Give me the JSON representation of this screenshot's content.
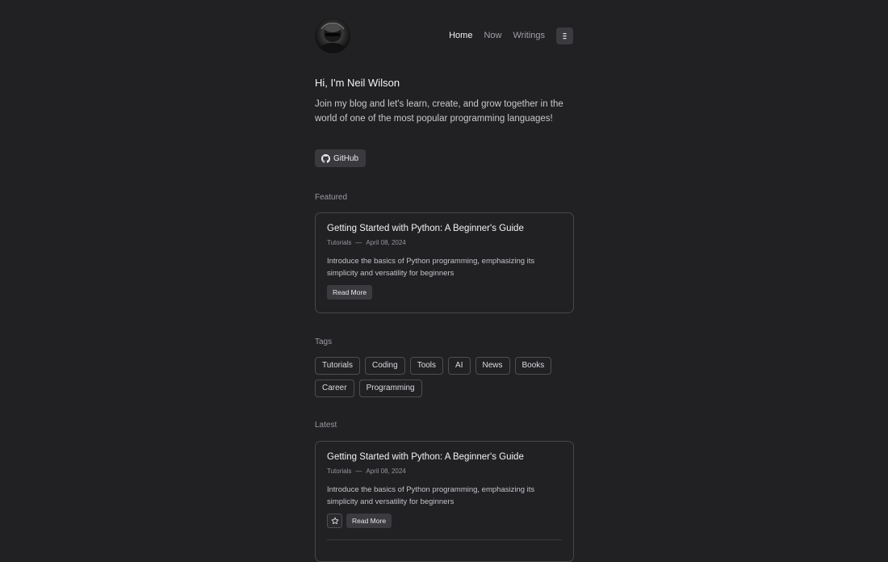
{
  "header": {
    "nav": [
      {
        "label": "Home",
        "active": true
      },
      {
        "label": "Now",
        "active": false
      },
      {
        "label": "Writings",
        "active": false
      }
    ]
  },
  "intro": {
    "greeting": "Hi, I'm Neil Wilson",
    "text": "Join my blog and let's learn, create, and grow together in the world of one of the most popular programming languages!",
    "github_label": "GitHub"
  },
  "featured": {
    "label": "Featured",
    "post": {
      "title": "Getting Started with Python: A Beginner's Guide",
      "category": "Tutorials",
      "separator": "—",
      "date": "April 08, 2024",
      "description": "Introduce the basics of Python programming, emphasizing its simplicity and versatility for beginners",
      "read_more": "Read More"
    }
  },
  "tags": {
    "label": "Tags",
    "items": [
      "Tutorials",
      "Coding",
      "Tools",
      "AI",
      "News",
      "Books",
      "Career",
      "Programming"
    ]
  },
  "latest": {
    "label": "Latest",
    "post": {
      "title": "Getting Started with Python: A Beginner's Guide",
      "category": "Tutorials",
      "separator": "—",
      "date": "April 08, 2024",
      "description": "Introduce the basics of Python programming, emphasizing its simplicity and versatility for beginners",
      "read_more": "Read More"
    }
  },
  "icons": {
    "menu": "menu-icon",
    "github": "github-icon",
    "star": "star-icon"
  }
}
